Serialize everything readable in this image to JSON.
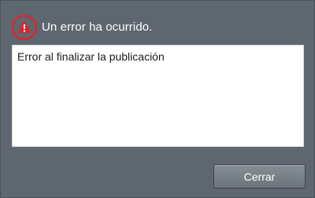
{
  "dialog": {
    "title": "Un error ha ocurrido.",
    "message": "Error al finalizar la publicación",
    "close_label": "Cerrar",
    "icon": "warning-icon"
  },
  "colors": {
    "background": "#5e676f",
    "warning_red": "#d7282f",
    "message_bg": "#ffffff"
  }
}
